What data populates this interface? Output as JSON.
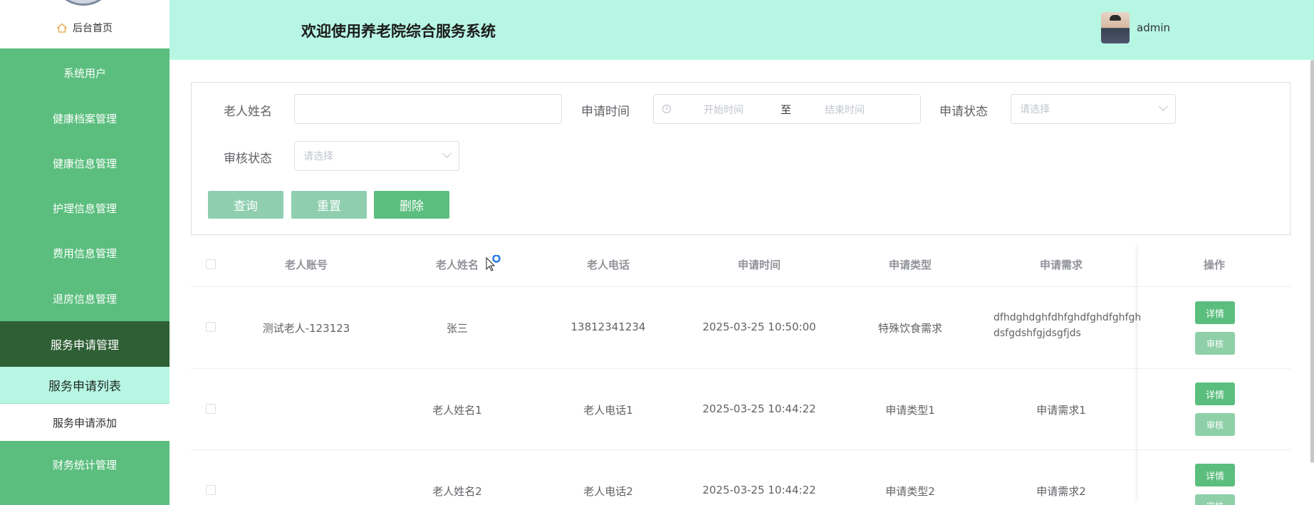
{
  "sidebar": {
    "home": "后台首页",
    "items": [
      {
        "label": "系统用户"
      },
      {
        "label": "健康档案管理"
      },
      {
        "label": "健康信息管理"
      },
      {
        "label": "护理信息管理"
      },
      {
        "label": "费用信息管理"
      },
      {
        "label": "退房信息管理"
      },
      {
        "label": "服务申请管理"
      },
      {
        "label": "服务申请列表"
      },
      {
        "label": "服务申请添加"
      },
      {
        "label": "财务统计管理"
      }
    ]
  },
  "header": {
    "title": "欢迎使用养老院综合服务系统",
    "username": "admin"
  },
  "search": {
    "name_label": "老人姓名",
    "name_value": "",
    "time_label": "申请时间",
    "start_placeholder": "开始时间",
    "range_sep": "至",
    "end_placeholder": "结束时间",
    "status_label": "申请状态",
    "status_placeholder": "请选择",
    "review_label": "审核状态",
    "review_placeholder": "请选择",
    "query_btn": "查询",
    "reset_btn": "重置",
    "delete_btn": "删除"
  },
  "table": {
    "headers": [
      "老人账号",
      "老人姓名",
      "老人电话",
      "申请时间",
      "申请类型",
      "申请需求",
      "操作"
    ],
    "rows": [
      {
        "account": "测试老人-123123",
        "name": "张三",
        "phone": "13812341234",
        "time": "2025-03-25 10:50:00",
        "type": "特殊饮食需求",
        "need_line1": "dfhdghdghfdhfghdfghdfghfgh",
        "need_line2": "dsfgdshfgjdsgfjds"
      },
      {
        "account": "",
        "name": "老人姓名1",
        "phone": "老人电话1",
        "time": "2025-03-25 10:44:22",
        "type": "申请类型1",
        "need_line1": "申请需求1",
        "need_line2": ""
      },
      {
        "account": "",
        "name": "老人姓名2",
        "phone": "老人电话2",
        "time": "2025-03-25 10:44:22",
        "type": "申请类型2",
        "need_line1": "申请需求2",
        "need_line2": ""
      }
    ],
    "detail_btn": "详情",
    "audit_btn": "审核"
  },
  "colors": {
    "sidebar": "#5bbe7e",
    "header": "#b8f6e4",
    "active_parent": "#2f5f35",
    "button_light": "#8fd0a9",
    "button_primary": "#5bbe7e"
  }
}
